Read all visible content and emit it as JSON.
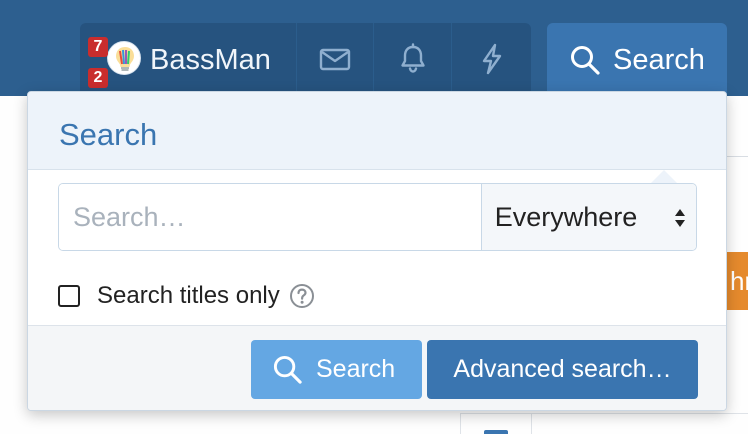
{
  "nav": {
    "username": "BassMan",
    "badges": [
      "7",
      "2"
    ],
    "icons": [
      "mail-icon",
      "bell-icon",
      "lightning-icon"
    ],
    "search_tab_label": "Search"
  },
  "background": {
    "partial_button_text": "hre"
  },
  "dropdown": {
    "title": "Search",
    "input_placeholder": "Search…",
    "input_value": "",
    "scope_selected": "Everywhere",
    "titles_only_label": "Search titles only",
    "titles_only_checked": false,
    "search_button_label": "Search",
    "advanced_button_label": "Advanced search…"
  },
  "colors": {
    "nav_bar": "#2d5f8f",
    "account_group": "#26537f",
    "search_tab": "#3a75b0",
    "header_bg": "#edf3fa",
    "primary_button": "#3a75b0",
    "search_button": "#64a7e3",
    "badge": "#c92d2d",
    "accent_orange": "#e58a2d"
  }
}
